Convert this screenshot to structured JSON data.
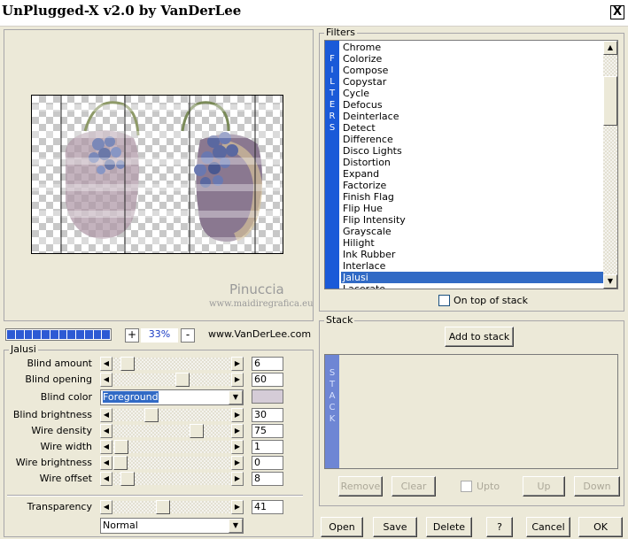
{
  "window": {
    "title": "UnPlugged-X v2.0 by VanDerLee",
    "close_glyph": "X"
  },
  "preview": {
    "watermark_text": "Pinuccia",
    "watermark_url": "www.maidiregrafica.eu"
  },
  "zoom": {
    "plus": "+",
    "value": "33%",
    "minus": "-",
    "progress_segments": 12
  },
  "link": {
    "text": "www.VanDerLee.com"
  },
  "jalusi": {
    "group_label": "Jalusi",
    "blind_amount": {
      "label": "Blind amount",
      "value": "6"
    },
    "blind_opening": {
      "label": "Blind opening",
      "value": "60"
    },
    "blind_color": {
      "label": "Blind color",
      "selected": "Foreground",
      "swatch_color": "#d5ccd7"
    },
    "blind_brightness": {
      "label": "Blind brightness",
      "value": "30"
    },
    "wire_density": {
      "label": "Wire density",
      "value": "75"
    },
    "wire_width": {
      "label": "Wire width",
      "value": "1"
    },
    "wire_brightness": {
      "label": "Wire brightness",
      "value": "0"
    },
    "wire_offset": {
      "label": "Wire offset",
      "value": "8"
    },
    "transparency": {
      "label": "Transparency",
      "value": "41"
    },
    "blend_mode": {
      "selected": "Normal"
    }
  },
  "filters": {
    "group_label": "Filters",
    "vertical_label": "FILTERS",
    "items": [
      "Chrome",
      "Colorize",
      "Compose",
      "Copystar",
      "Cycle",
      "Defocus",
      "Deinterlace",
      "Detect",
      "Difference",
      "Disco Lights",
      "Distortion",
      "Expand",
      "Factorize",
      "Finish Flag",
      "Flip Hue",
      "Flip Intensity",
      "Grayscale",
      "Hilight",
      "Ink Rubber",
      "Interlace",
      "Jalusi",
      "Lacerate"
    ],
    "selected": "Jalusi",
    "on_top_label": "On top of stack"
  },
  "stack": {
    "group_label": "Stack",
    "vertical_label": "STACK",
    "add_label": "Add to stack",
    "remove_label": "Remove",
    "clear_label": "Clear",
    "upto_label": "Upto",
    "up_label": "Up",
    "down_label": "Down"
  },
  "footer": {
    "open_label": "Open",
    "save_label": "Save",
    "delete_label": "Delete",
    "help_label": "?",
    "cancel_label": "Cancel",
    "ok_label": "OK"
  },
  "colors": {
    "accent_blue": "#1a5ad8",
    "selection": "#316ac5",
    "window_bg": "#ece9d8"
  }
}
